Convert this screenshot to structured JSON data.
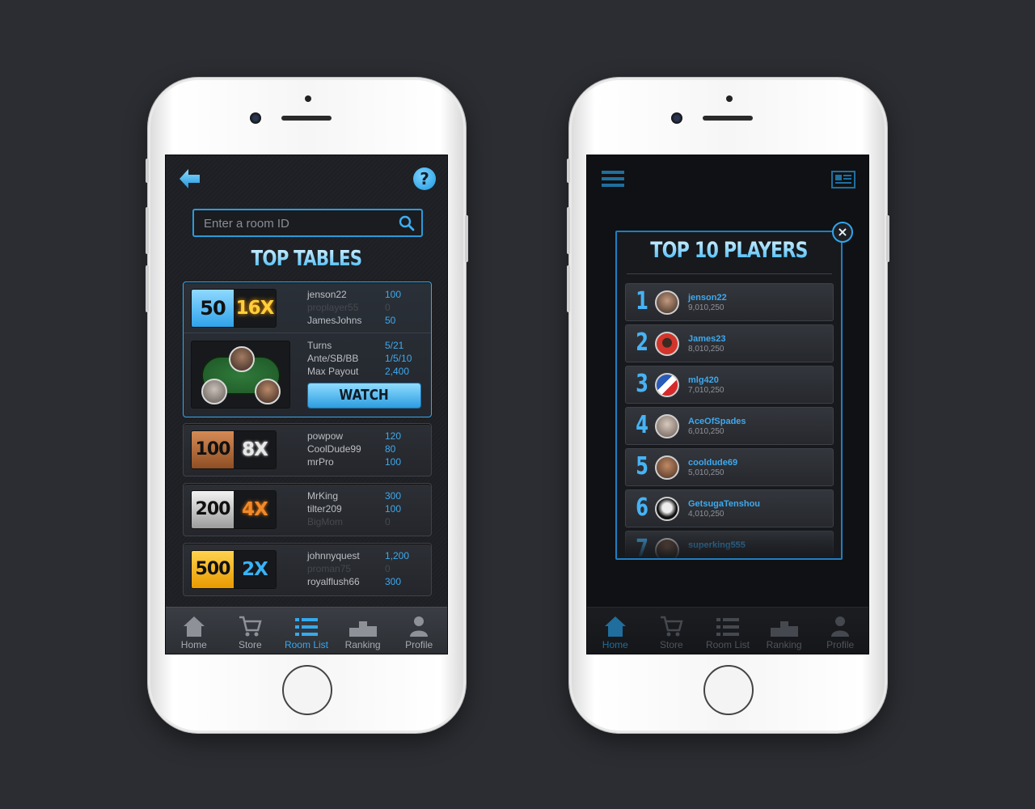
{
  "left": {
    "search": {
      "placeholder": "Enter a room ID"
    },
    "title": "TOP TABLES",
    "featured": {
      "blind": "50",
      "multiplier": "16X",
      "players": [
        {
          "name": "jenson22",
          "score": "100",
          "empty": false
        },
        {
          "name": "proplayer55",
          "score": "0",
          "empty": true
        },
        {
          "name": "JamesJohns",
          "score": "50",
          "empty": false
        }
      ],
      "info": [
        {
          "label": "Turns",
          "value": "5/21"
        },
        {
          "label": "Ante/SB/BB",
          "value": "1/5/10"
        },
        {
          "label": "Max Payout",
          "value": "2,400"
        }
      ],
      "watch_label": "WATCH"
    },
    "tables": [
      {
        "blind": "100",
        "multiplier": "8X",
        "players": [
          {
            "name": "powpow",
            "score": "120"
          },
          {
            "name": "CoolDude99",
            "score": "80"
          },
          {
            "name": "mrPro",
            "score": "100"
          }
        ]
      },
      {
        "blind": "200",
        "multiplier": "4X",
        "players": [
          {
            "name": "MrKing",
            "score": "300"
          },
          {
            "name": "tilter209",
            "score": "100"
          },
          {
            "name": "BigMom",
            "score": "0"
          }
        ]
      },
      {
        "blind": "500",
        "multiplier": "2X",
        "players": [
          {
            "name": "johnnyquest",
            "score": "1,200"
          },
          {
            "name": "proman75",
            "score": "0"
          },
          {
            "name": "royalflush66",
            "score": "300"
          }
        ]
      }
    ],
    "tabs": [
      "Home",
      "Store",
      "Room List",
      "Ranking",
      "Profile"
    ],
    "active_tab": "Room List"
  },
  "right": {
    "modal_title": "TOP 10 PLAYERS",
    "close_label": "×",
    "players": [
      {
        "rank": "1",
        "name": "jenson22",
        "score": "9,010,250"
      },
      {
        "rank": "2",
        "name": "James23",
        "score": "8,010,250"
      },
      {
        "rank": "3",
        "name": "mlg420",
        "score": "7,010,250"
      },
      {
        "rank": "4",
        "name": "AceOfSpades",
        "score": "6,010,250"
      },
      {
        "rank": "5",
        "name": "cooldude69",
        "score": "5,010,250"
      },
      {
        "rank": "6",
        "name": "GetsugaTenshou",
        "score": "4,010,250"
      },
      {
        "rank": "7",
        "name": "superking555",
        "score": ""
      }
    ],
    "tabs": [
      "Home",
      "Store",
      "Room List",
      "Ranking",
      "Profile"
    ],
    "active_tab": "Home"
  },
  "colors": {
    "accent": "#35a9ef",
    "blind_blue": "#3ab0f5",
    "blind_bronze": "#b86f3c",
    "blind_silver": "#c8c8c8",
    "blind_gold": "#f4b017"
  }
}
